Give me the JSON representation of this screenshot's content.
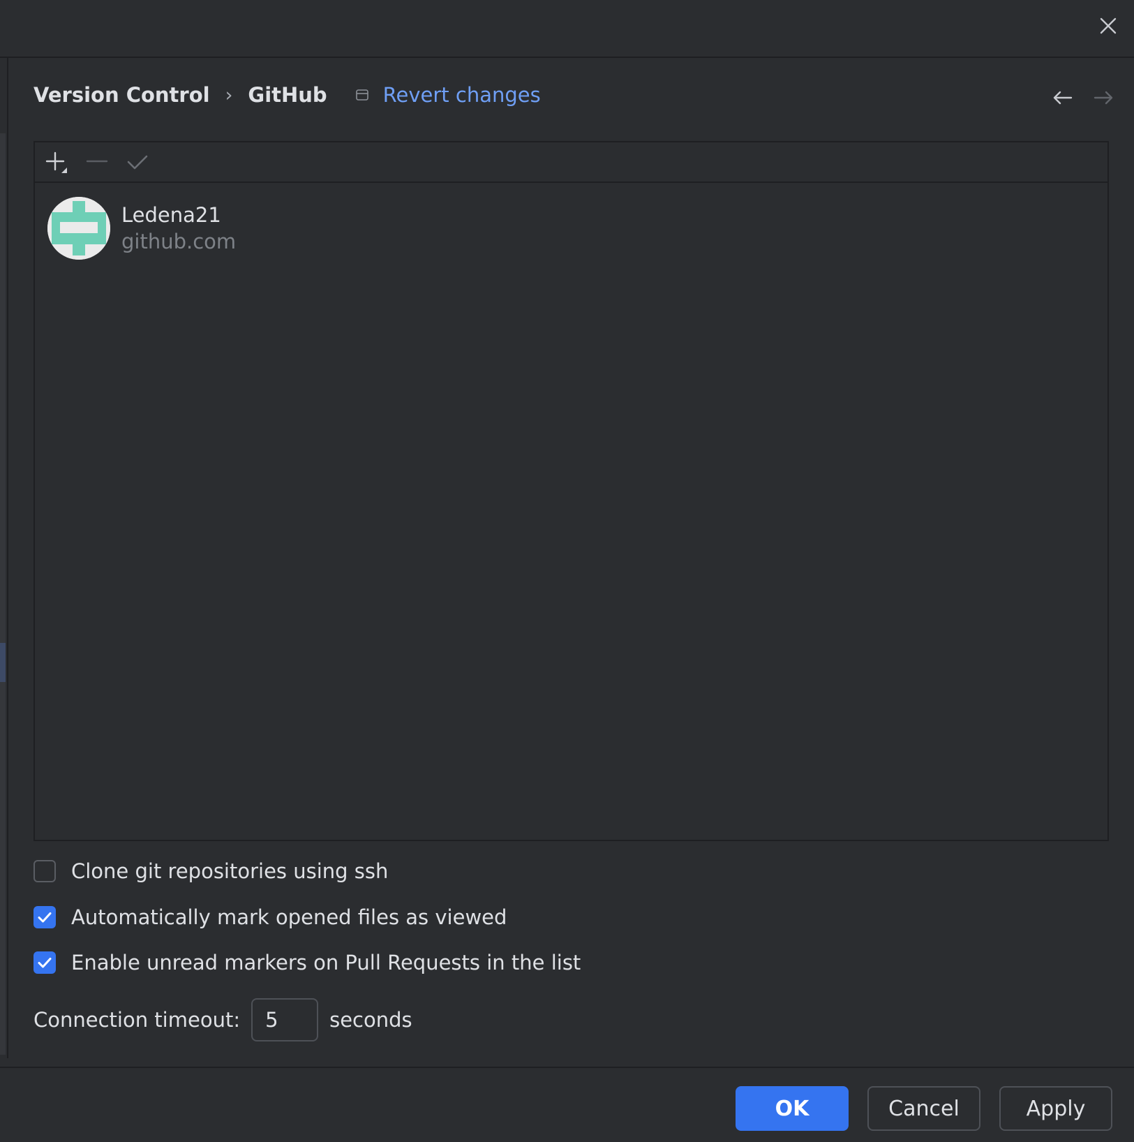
{
  "dialog": {
    "close_icon": "close-icon"
  },
  "breadcrumb": {
    "parent": "Version Control",
    "separator": "›",
    "current": "GitHub",
    "revert_icon": "revert-icon",
    "revert_label": "Revert changes"
  },
  "navigation": {
    "back_icon": "arrow-left-icon",
    "forward_icon": "arrow-right-icon"
  },
  "accounts_toolbar": {
    "add_icon": "plus-icon",
    "remove_icon": "minus-icon",
    "set_default_icon": "check-icon"
  },
  "accounts": [
    {
      "name": "Ledena21",
      "host": "github.com",
      "avatar_color": "#6ecfb6"
    }
  ],
  "options": [
    {
      "label": "Clone git repositories using ssh",
      "checked": false
    },
    {
      "label": "Automatically mark opened files as viewed",
      "checked": true
    },
    {
      "label": "Enable unread markers on Pull Requests in the list",
      "checked": true
    }
  ],
  "timeout": {
    "label": "Connection timeout:",
    "value": "5",
    "unit": "seconds"
  },
  "footer": {
    "ok_label": "OK",
    "cancel_label": "Cancel",
    "apply_label": "Apply"
  },
  "colors": {
    "background": "#2b2d30",
    "accent": "#3574f0",
    "link": "#6f9ff5"
  }
}
